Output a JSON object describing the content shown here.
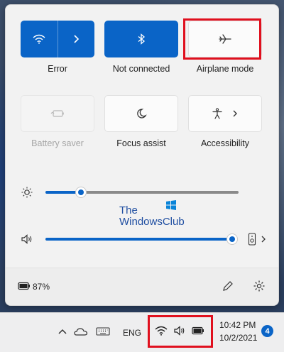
{
  "tiles": [
    {
      "label": "Error",
      "icon": "wifi-icon"
    },
    {
      "label": "Not connected",
      "icon": "bluetooth-icon"
    },
    {
      "label": "Airplane mode",
      "icon": "airplane-icon"
    },
    {
      "label": "Battery saver",
      "icon": "battery-saver-icon"
    },
    {
      "label": "Focus assist",
      "icon": "moon-icon"
    },
    {
      "label": "Accessibility",
      "icon": "accessibility-icon"
    }
  ],
  "sliders": {
    "brightness": {
      "icon": "sun-icon",
      "level": 0.2
    },
    "volume": {
      "icon": "speaker-icon",
      "level": 1.0
    }
  },
  "watermark": {
    "line1": "The",
    "line2": "WindowsClub"
  },
  "footer": {
    "battery": "87%"
  },
  "taskbar": {
    "language": "ENG",
    "time": "10:42 PM",
    "date": "10/2/2021",
    "notifications": "4"
  },
  "colors": {
    "accent": "#0a64c7",
    "highlight": "#e0101e"
  }
}
